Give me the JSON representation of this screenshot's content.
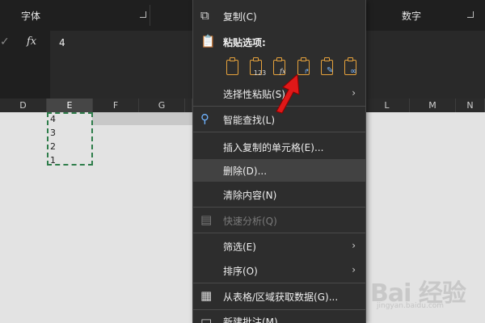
{
  "ribbon": {
    "group_font": "字体",
    "group_number": "数字"
  },
  "formula_bar": {
    "fx_label": "fx",
    "value": "4"
  },
  "columns": [
    "D",
    "E",
    "F",
    "G",
    "L",
    "M",
    "N"
  ],
  "cells": [
    "4",
    "3",
    "2",
    "1"
  ],
  "context_menu": {
    "copy": "复制(C)",
    "paste_options_title": "粘贴选项:",
    "paste_options": [
      {
        "icon": "paste-icon",
        "sub": ""
      },
      {
        "icon": "paste-values-icon",
        "sub": "123"
      },
      {
        "icon": "paste-formulas-icon",
        "sub": "fx"
      },
      {
        "icon": "paste-transpose-icon",
        "sub": ""
      },
      {
        "icon": "paste-formatting-icon",
        "sub": ""
      },
      {
        "icon": "paste-link-icon",
        "sub": ""
      }
    ],
    "paste_special": "选择性粘贴(S)",
    "smart_lookup": "智能查找(L)",
    "insert_copied": "插入复制的单元格(E)...",
    "delete": "删除(D)...",
    "clear_contents": "清除内容(N)",
    "quick_analysis": "快速分析(Q)",
    "filter": "筛选(E)",
    "sort": "排序(O)",
    "get_data": "从表格/区域获取数据(G)...",
    "new_comment": "新建批注(M)"
  },
  "colors": {
    "accent_orange": "#e6a23c",
    "marquee_green": "#2e7d4a",
    "arrow_red": "#e01818"
  }
}
